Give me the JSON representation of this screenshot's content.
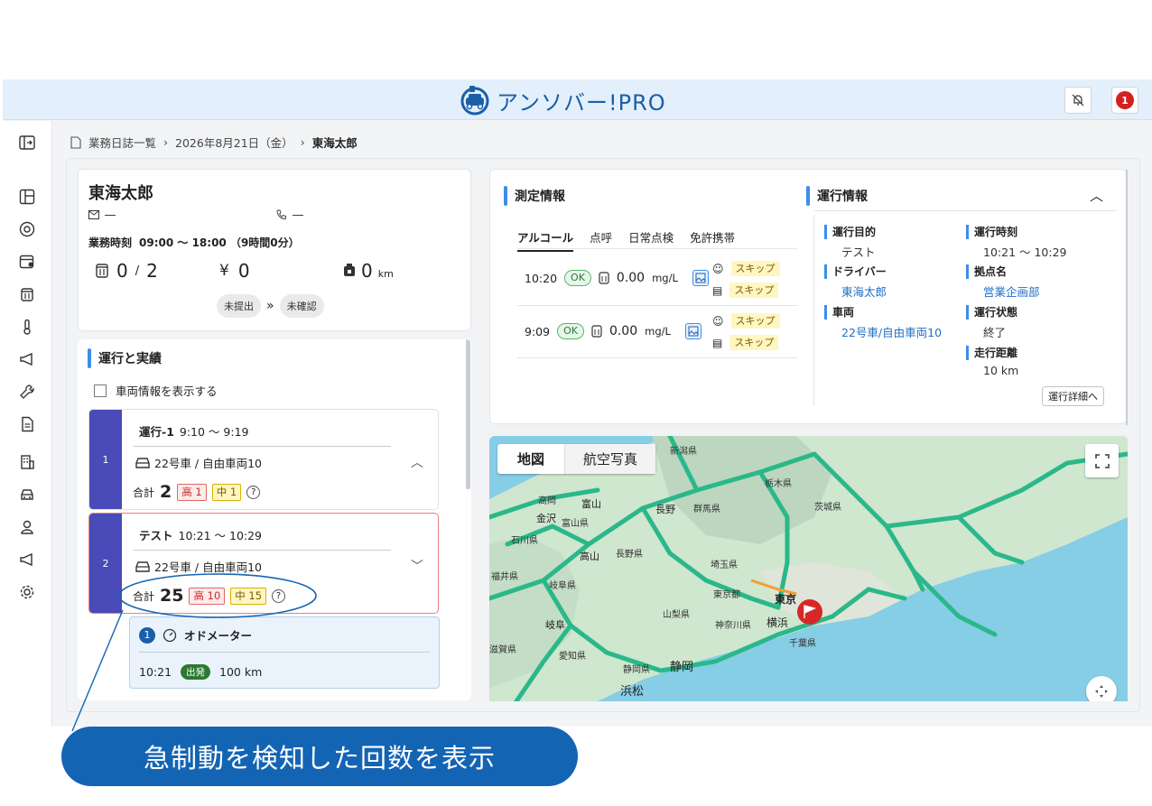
{
  "app": {
    "title": "アンソバー!PRO",
    "notification_count": "1"
  },
  "breadcrumb": {
    "root": "業務日誌一覧",
    "date": "2026年8月21日（金）",
    "current": "東海太郎"
  },
  "driver_card": {
    "name": "東海太郎",
    "email": "―",
    "phone": "―",
    "work_time_label": "業務時刻",
    "work_time_value": "09:00 〜 18:00 （9時間0分）",
    "measure_count": "0",
    "measure_total": "2",
    "yen_symbol": "¥",
    "yen_value": "0",
    "distance_value": "0",
    "distance_unit": "km",
    "status_submit": "未提出",
    "status_confirm": "未確認"
  },
  "trips_section": {
    "title": "運行と実績",
    "show_vehicle_label": "車両情報を表示する",
    "trips": [
      {
        "num": "1",
        "name": "運行-1",
        "time": "9:10 〜 9:19",
        "vehicle": "22号車 / 自由車両10",
        "total_label": "合計",
        "total": "2",
        "high": "高 1",
        "mid": "中 1"
      },
      {
        "num": "2",
        "name": "テスト",
        "time": "10:21 〜 10:29",
        "vehicle": "22号車 / 自由車両10",
        "total_label": "合計",
        "total": "25",
        "high": "高 10",
        "mid": "中 15"
      }
    ],
    "odometer": {
      "index": "1",
      "title": "オドメーター",
      "time": "10:21",
      "badge": "出発",
      "value": "100 km"
    }
  },
  "measure": {
    "title": "測定情報",
    "tabs": [
      "アルコール",
      "点呼",
      "日常点検",
      "免許携帯"
    ],
    "rows": [
      {
        "time": "10:20",
        "status": "OK",
        "value": "0.00",
        "unit": "mg/L",
        "skip1": "スキップ",
        "skip2": "スキップ"
      },
      {
        "time": "9:09",
        "status": "OK",
        "value": "0.00",
        "unit": "mg/L",
        "skip1": "スキップ",
        "skip2": "スキップ"
      }
    ]
  },
  "operation": {
    "title": "運行情報",
    "purpose_label": "運行目的",
    "purpose": "テスト",
    "time_label": "運行時刻",
    "time": "10:21 〜 10:29",
    "driver_label": "ドライバー",
    "driver": "東海太郎",
    "base_label": "拠点名",
    "base": "営業企画部",
    "vehicle_label": "車両",
    "vehicle": "22号車/自由車両10",
    "status_label": "運行状態",
    "status": "終了",
    "distance_label": "走行距離",
    "distance": "10 km",
    "detail_button": "運行詳細へ"
  },
  "map": {
    "tab_map": "地図",
    "tab_aerial": "航空写真",
    "labels": [
      "新潟県",
      "栃木県",
      "群馬県",
      "茨城県",
      "高岡",
      "富山",
      "長野",
      "金沢",
      "石川県",
      "富山県",
      "高山",
      "長野県",
      "福井県",
      "岐阜県",
      "埼玉県",
      "東京都",
      "東京",
      "山梨県",
      "神奈川県",
      "横浜",
      "千葉県",
      "岐阜",
      "愛知県",
      "静岡県",
      "静岡",
      "浜松",
      "滋賀県"
    ]
  },
  "callout": "急制動を検知した回数を表示"
}
